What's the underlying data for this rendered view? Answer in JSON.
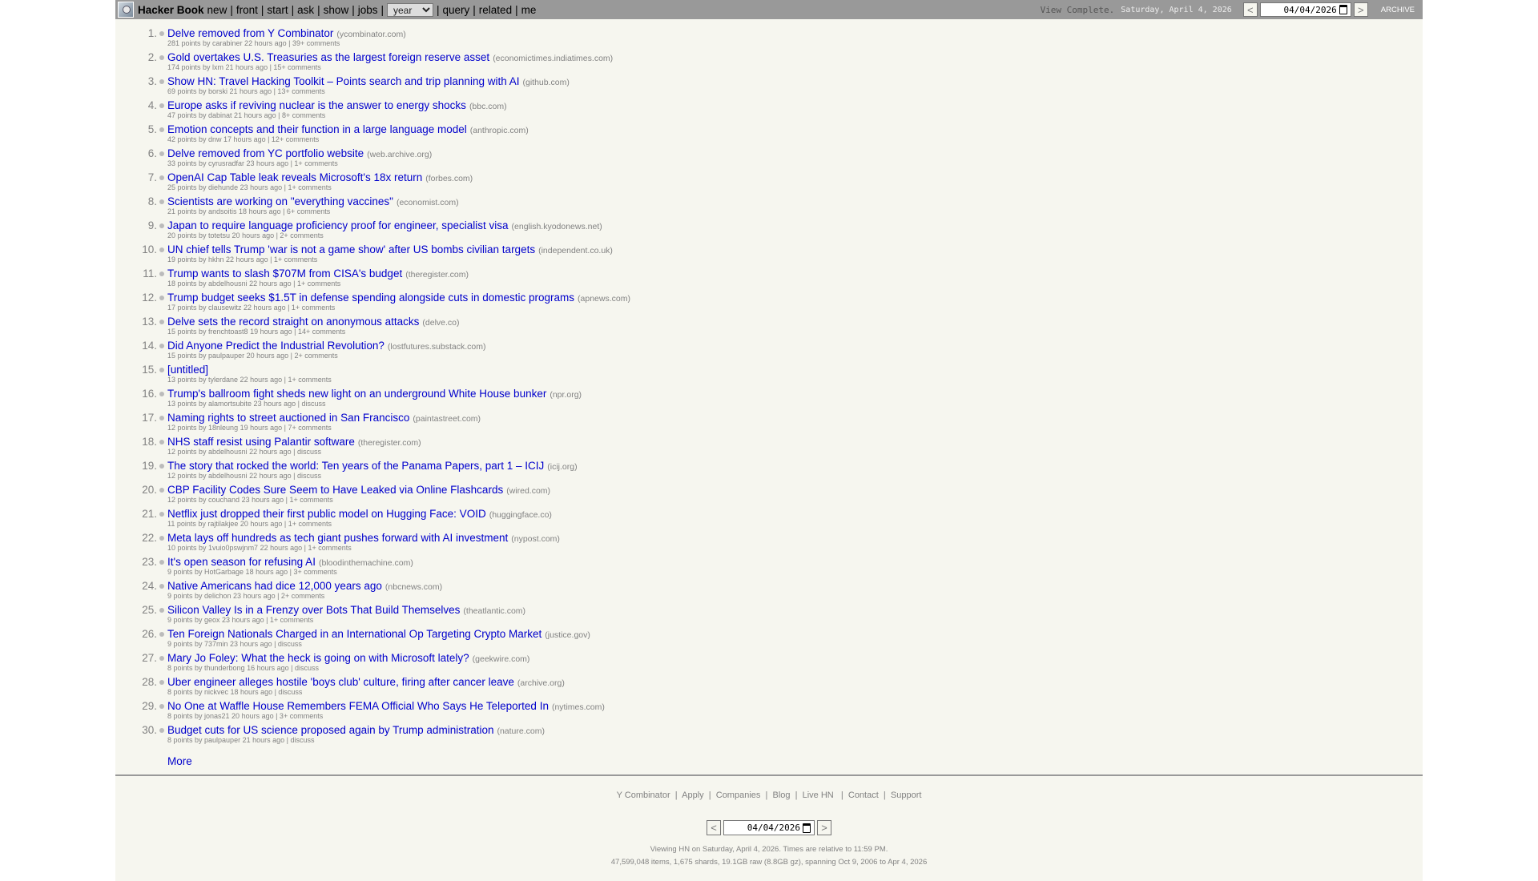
{
  "header": {
    "brand": "Hacker Book",
    "nav": [
      "new",
      "front",
      "start",
      "ask",
      "show",
      "jobs"
    ],
    "period": "year",
    "nav2": [
      "query",
      "related",
      "me"
    ],
    "status": "View Complete.",
    "date_text": "Saturday, April 4, 2026",
    "prev": "<",
    "next": ">",
    "date_value": "04/04/2026",
    "archive": "ARCHIVE"
  },
  "items": [
    {
      "rank": "1.",
      "title": "Delve removed from Y Combinator",
      "site": "(ycombinator.com)",
      "sub": "281 points by carabiner 22 hours ago | 39+ comments"
    },
    {
      "rank": "2.",
      "title": "Gold overtakes U.S. Treasuries as the largest foreign reserve asset",
      "site": "(economictimes.indiatimes.com)",
      "sub": "174 points by lxm 21 hours ago | 15+ comments"
    },
    {
      "rank": "3.",
      "title": "Show HN: Travel Hacking Toolkit – Points search and trip planning with AI",
      "site": "(github.com)",
      "sub": "69 points by borski 21 hours ago | 13+ comments"
    },
    {
      "rank": "4.",
      "title": "Europe asks if reviving nuclear is the answer to energy shocks",
      "site": "(bbc.com)",
      "sub": "47 points by dabinat 21 hours ago | 8+ comments"
    },
    {
      "rank": "5.",
      "title": "Emotion concepts and their function in a large language model",
      "site": "(anthropic.com)",
      "sub": "42 points by dnw 17 hours ago | 12+ comments"
    },
    {
      "rank": "6.",
      "title": "Delve removed from YC portfolio website",
      "site": "(web.archive.org)",
      "sub": "33 points by cyrusradfar 23 hours ago | 1+ comments"
    },
    {
      "rank": "7.",
      "title": "OpenAI Cap Table leak reveals Microsoft's 18x return",
      "site": "(forbes.com)",
      "sub": "25 points by diehunde 23 hours ago | 1+ comments"
    },
    {
      "rank": "8.",
      "title": "Scientists are working on \"everything vaccines\"",
      "site": "(economist.com)",
      "sub": "21 points by andsoitis 18 hours ago | 6+ comments"
    },
    {
      "rank": "9.",
      "title": "Japan to require language proficiency proof for engineer, specialist visa",
      "site": "(english.kyodonews.net)",
      "sub": "20 points by totetsu 20 hours ago | 2+ comments"
    },
    {
      "rank": "10.",
      "title": "UN chief tells Trump 'war is not a game show' after US bombs civilian targets",
      "site": "(independent.co.uk)",
      "sub": "19 points by hkhn 22 hours ago | 1+ comments"
    },
    {
      "rank": "11.",
      "title": "Trump wants to slash $707M from CISA's budget",
      "site": "(theregister.com)",
      "sub": "18 points by abdelhousni 22 hours ago | 1+ comments"
    },
    {
      "rank": "12.",
      "title": "Trump budget seeks $1.5T in defense spending alongside cuts in domestic programs",
      "site": "(apnews.com)",
      "sub": "17 points by clausewitz 22 hours ago | 1+ comments"
    },
    {
      "rank": "13.",
      "title": "Delve sets the record straight on anonymous attacks",
      "site": "(delve.co)",
      "sub": "15 points by frenchtoast8 19 hours ago | 14+ comments"
    },
    {
      "rank": "14.",
      "title": "Did Anyone Predict the Industrial Revolution?",
      "site": "(lostfutures.substack.com)",
      "sub": "15 points by paulpauper 20 hours ago | 2+ comments"
    },
    {
      "rank": "15.",
      "title": "[untitled]",
      "site": "",
      "sub": "13 points by tylerdane 22 hours ago | 1+ comments"
    },
    {
      "rank": "16.",
      "title": "Trump's ballroom fight sheds new light on an underground White House bunker",
      "site": "(npr.org)",
      "sub": "13 points by alamortsubite 23 hours ago | discuss"
    },
    {
      "rank": "17.",
      "title": "Naming rights to street auctioned in San Francisco",
      "site": "(paintastreet.com)",
      "sub": "12 points by 18nleung 19 hours ago | 7+ comments"
    },
    {
      "rank": "18.",
      "title": "NHS staff resist using Palantir software",
      "site": "(theregister.com)",
      "sub": "12 points by abdelhousni 22 hours ago | discuss"
    },
    {
      "rank": "19.",
      "title": "The story that rocked the world: Ten years of the Panama Papers, part 1 – ICIJ",
      "site": "(icij.org)",
      "sub": "12 points by abdelhousni 22 hours ago | discuss"
    },
    {
      "rank": "20.",
      "title": "CBP Facility Codes Sure Seem to Have Leaked via Online Flashcards",
      "site": "(wired.com)",
      "sub": "12 points by couchand 23 hours ago | 1+ comments"
    },
    {
      "rank": "21.",
      "title": "Netflix just dropped their first public model on Hugging Face: VOID",
      "site": "(huggingface.co)",
      "sub": "11 points by rajtilakjee 20 hours ago | 1+ comments"
    },
    {
      "rank": "22.",
      "title": "Meta lays off hundreds as tech giant pushes forward with AI investment",
      "site": "(nypost.com)",
      "sub": "10 points by 1vuio0pswjnm7 22 hours ago | 1+ comments"
    },
    {
      "rank": "23.",
      "title": "It's open season for refusing AI",
      "site": "(bloodinthemachine.com)",
      "sub": "9 points by HotGarbage 18 hours ago | 3+ comments"
    },
    {
      "rank": "24.",
      "title": "Native Americans had dice 12,000 years ago",
      "site": "(nbcnews.com)",
      "sub": "9 points by delichon 23 hours ago | 2+ comments"
    },
    {
      "rank": "25.",
      "title": "Silicon Valley Is in a Frenzy over Bots That Build Themselves",
      "site": "(theatlantic.com)",
      "sub": "9 points by geox 23 hours ago | 1+ comments"
    },
    {
      "rank": "26.",
      "title": "Ten Foreign Nationals Charged in an International Op Targeting Crypto Market",
      "site": "(justice.gov)",
      "sub": "9 points by 737min 23 hours ago | discuss"
    },
    {
      "rank": "27.",
      "title": "Mary Jo Foley: What the heck is going on with Microsoft lately?",
      "site": "(geekwire.com)",
      "sub": "8 points by thunderbong 16 hours ago | discuss"
    },
    {
      "rank": "28.",
      "title": "Uber engineer alleges hostile 'boys club' culture, firing after cancer leave",
      "site": "(archive.org)",
      "sub": "8 points by nickvec 18 hours ago | discuss"
    },
    {
      "rank": "29.",
      "title": "No One at Waffle House Remembers FEMA Official Who Says He Teleported In",
      "site": "(nytimes.com)",
      "sub": "8 points by jonas21 20 hours ago | 3+ comments"
    },
    {
      "rank": "30.",
      "title": "Budget cuts for US science proposed again by Trump administration",
      "site": "(nature.com)",
      "sub": "8 points by paulpauper 21 hours ago | discuss"
    }
  ],
  "more": "More",
  "footer": {
    "links": [
      "Y Combinator",
      "Apply",
      "Companies",
      "Blog",
      "Live HN",
      "Contact",
      "Support"
    ],
    "prev": "<",
    "next": ">",
    "date_value": "04/04/2026",
    "viewing": "Viewing HN on Saturday, April 4, 2026. Times are relative to 11:59 PM.",
    "stats": "47,599,048 items, 1,675 shards, 19.1GB raw (8.8GB gz), spanning Oct 9, 2006 to Apr 4, 2026"
  }
}
